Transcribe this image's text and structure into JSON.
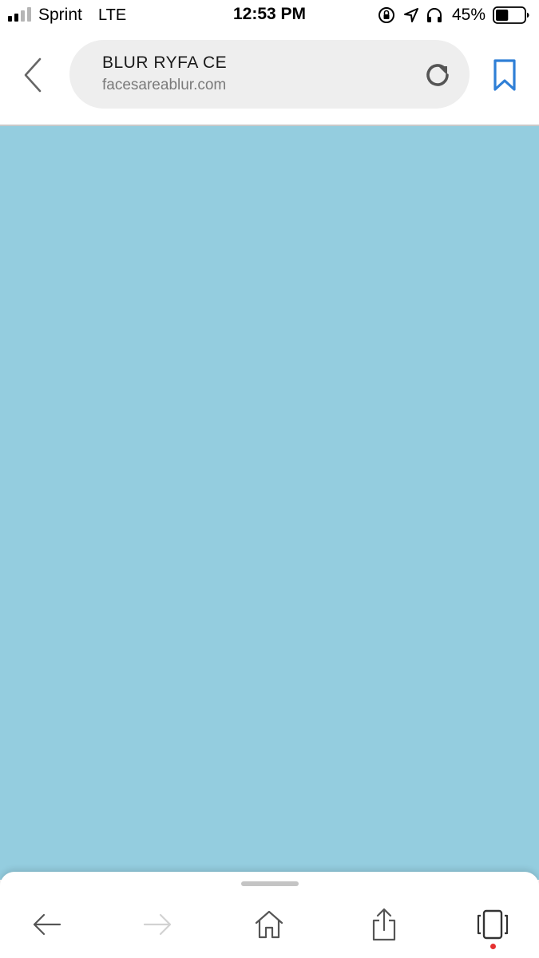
{
  "status_bar": {
    "carrier": "Sprint",
    "network": "LTE",
    "time": "12:53 PM",
    "battery_percent": "45%",
    "battery_level": 0.45,
    "signal_bars_filled": 2,
    "signal_bars_total": 4,
    "icons": [
      "orientation-lock-icon",
      "location-arrow-icon",
      "headphones-icon",
      "battery-icon"
    ]
  },
  "browser": {
    "page_title": "BLUR RYFA CE",
    "url": "facesareablur.com",
    "bookmark_color": "#2f7fd6",
    "icons": [
      "back-chevron-icon",
      "reload-icon",
      "bookmark-icon"
    ]
  },
  "content": {
    "background_color": "#94cddf"
  },
  "bottom_nav": {
    "items": [
      {
        "name": "back",
        "icon": "arrow-left-icon",
        "enabled": true
      },
      {
        "name": "forward",
        "icon": "arrow-right-icon",
        "enabled": false
      },
      {
        "name": "home",
        "icon": "home-icon",
        "enabled": true
      },
      {
        "name": "share",
        "icon": "share-icon",
        "enabled": true
      },
      {
        "name": "tabs",
        "icon": "tabs-icon",
        "enabled": true,
        "badge_dot": true
      }
    ],
    "badge_color": "#e53030"
  }
}
